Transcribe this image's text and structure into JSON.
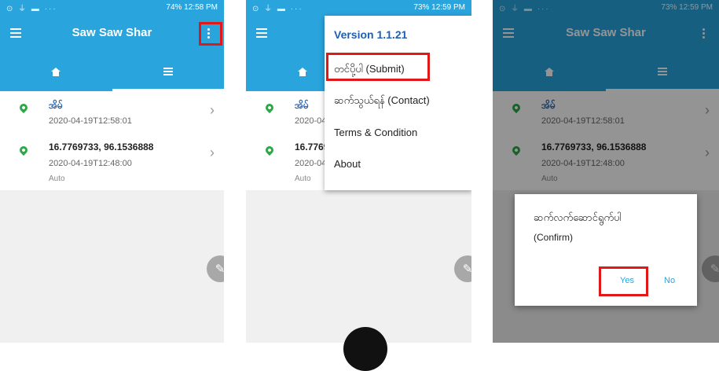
{
  "app": {
    "title": "Saw Saw Shar",
    "accent": "#29a4dc",
    "highlight": "#e01818"
  },
  "screens": [
    {
      "status": {
        "right": "74% 12:58 PM"
      }
    },
    {
      "status": {
        "right": "73% 12:59 PM"
      }
    },
    {
      "status": {
        "right": "73% 12:59 PM"
      }
    }
  ],
  "tabs": [
    {
      "icon": "home-icon"
    },
    {
      "icon": "list-icon"
    }
  ],
  "records": [
    {
      "title": "အိမ်",
      "timestamp": "2020-04-19T12:58:01",
      "mode": ""
    },
    {
      "title": "16.7769733, 96.1536888",
      "timestamp": "2020-04-19T12:48:00",
      "mode": "Auto"
    }
  ],
  "menu": {
    "version": "Version 1.1.21",
    "submit": "တင်ပို့ပါ (Submit)",
    "contact": "ဆက်သွယ်ရန် (Contact)",
    "terms": "Terms & Condition",
    "about": "About"
  },
  "dialog": {
    "message": "ဆက်လက်ဆောင်ရွက်ပါ",
    "sub": "(Confirm)",
    "yes": "Yes",
    "no": "No"
  }
}
